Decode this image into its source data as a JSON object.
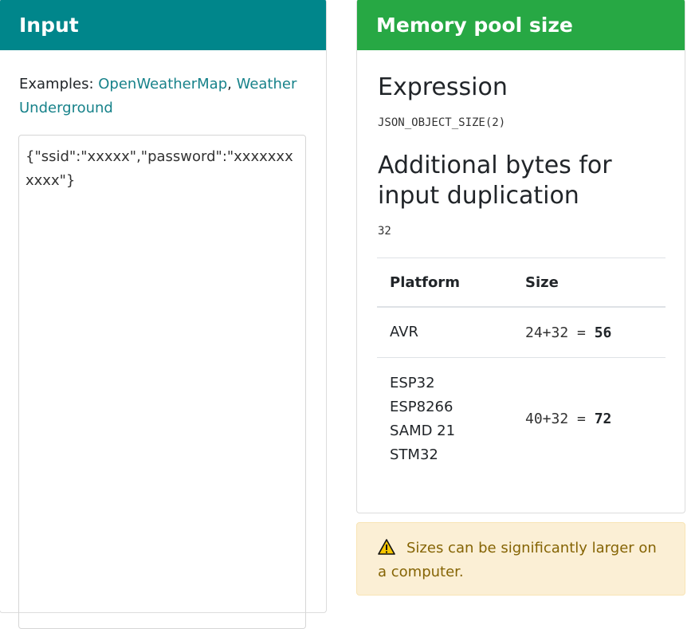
{
  "input": {
    "header": "Input",
    "examples_prefix": "Examples: ",
    "example_links": [
      "OpenWeatherMap",
      "Weather Underground"
    ],
    "examples_separator": ", ",
    "json_text": "{\"ssid\":\"xxxxx\",\"password\":\"xxxxxxxxxxx\"}"
  },
  "memory": {
    "header": "Memory pool size",
    "expression_heading": "Expression",
    "expression_value": "JSON_OBJECT_SIZE(2)",
    "additional_heading": "Additional bytes for input duplication",
    "additional_value": "32",
    "table": {
      "columns": [
        "Platform",
        "Size"
      ],
      "rows": [
        {
          "platforms": [
            "AVR"
          ],
          "expr": "24+32 = ",
          "total": "56"
        },
        {
          "platforms": [
            "ESP32",
            "ESP8266",
            "SAMD 21",
            "STM32"
          ],
          "expr": "40+32 = ",
          "total": "72"
        }
      ]
    }
  },
  "alert": {
    "icon": "warning-icon",
    "text": "Sizes can be significantly larger on a computer."
  },
  "colors": {
    "input_header": "#00868b",
    "memory_header": "#27a844",
    "link": "#17828a",
    "alert_bg": "#fbefd5",
    "alert_text": "#856404"
  }
}
